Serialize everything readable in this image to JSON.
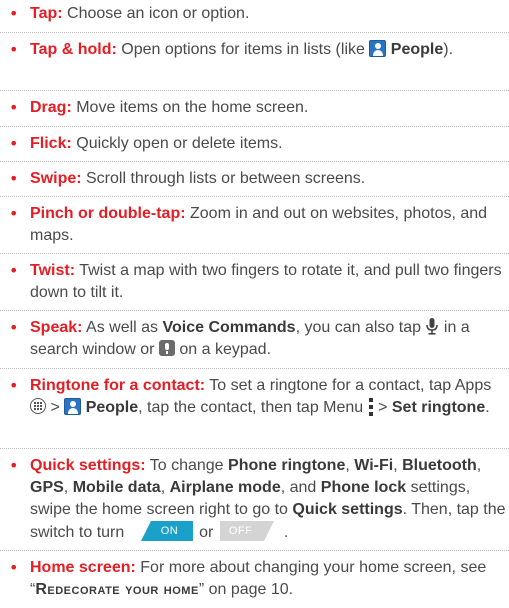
{
  "colors": {
    "accent": "#e31e24",
    "text": "#4a4a4a",
    "toggle_on": "#1aa1c9",
    "toggle_off": "#bdbdbd"
  },
  "bullet_glyph": "•",
  "items": {
    "tap": {
      "term": "Tap:",
      "text": " Choose an icon or option."
    },
    "tap_hold": {
      "term": "Tap & hold:",
      "text": " Open options for items in lists (like ",
      "people": "People",
      "end": ")."
    },
    "drag": {
      "term": "Drag:",
      "text": " Move items on the home screen."
    },
    "flick": {
      "term": "Flick:",
      "text": " Quickly open or delete items."
    },
    "swipe": {
      "term": "Swipe:",
      "text": " Scroll through lists or between screens."
    },
    "pinch": {
      "term": "Pinch or double-tap:",
      "text": " Zoom in and out on websites, photos, and maps."
    },
    "twist": {
      "term": "Twist:",
      "text": " Twist a map with two fingers to rotate it, and pull two fingers down to tilt it."
    },
    "speak": {
      "term": "Speak:",
      "t1": " As well as ",
      "voice_commands": "Voice Commands",
      "t2": ", you can also tap ",
      "t3": " in a search window or ",
      "t4": " on a keypad."
    },
    "ringtone": {
      "term": "Ringtone for a contact:",
      "t1": " To set a ringtone for a contact, tap Apps ",
      "t2": " > ",
      "people": "People",
      "t3": ", tap the contact, then tap Menu ",
      "t4": " > ",
      "set_ringtone": "Set ringtone",
      "t5": "."
    },
    "quick": {
      "term": "Quick settings:",
      "t1": " To change ",
      "phone_ringtone": "Phone ringtone",
      "wifi": "Wi-Fi",
      "bluetooth": "Bluetooth",
      "gps": "GPS",
      "mobile_data": "Mobile data",
      "airplane_mode": "Airplane mode",
      "phone_lock": "Phone lock",
      "comma": ", ",
      "and": ", and ",
      "t2": " settings, swipe the home screen right to go to ",
      "quick_settings": "Quick settings",
      "t3": ". Then, tap the switch to turn ",
      "or": " or ",
      "end": ".",
      "on_label": "ON",
      "off_label": "OFF"
    },
    "home": {
      "term": "Home screen:",
      "t1": " For more about changing your home screen, see “",
      "redecorate": "Redecorate your home",
      "t2": "” on page 10."
    }
  },
  "icons": [
    "people-icon",
    "mic-icon",
    "keyboard-mic-icon",
    "apps-icon",
    "menu-icon",
    "toggle-switch"
  ]
}
